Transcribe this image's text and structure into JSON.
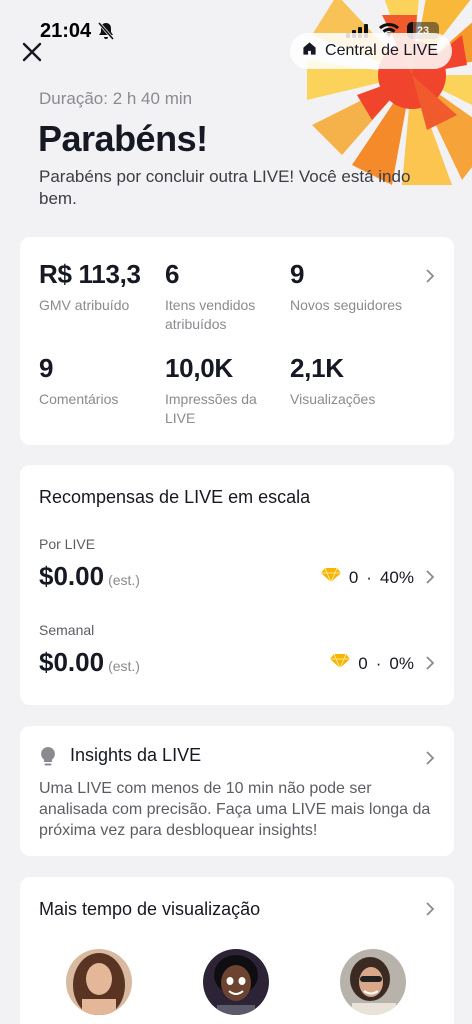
{
  "status": {
    "time": "21:04",
    "battery": "23"
  },
  "header": {
    "center_label": "Central de LIVE"
  },
  "summary": {
    "duration": "Duração: 2 h 40 min",
    "title": "Parabéns!",
    "subtitle": "Parabéns por concluir outra LIVE! Você está indo bem."
  },
  "stats": [
    {
      "value": "R$ 113,3",
      "label": "GMV atribuído"
    },
    {
      "value": "6",
      "label": "Itens vendidos atribuídos"
    },
    {
      "value": "9",
      "label": "Novos seguidores"
    },
    {
      "value": "9",
      "label": "Comentários"
    },
    {
      "value": "10,0K",
      "label": "Impressões da LIVE"
    },
    {
      "value": "2,1K",
      "label": "Visualizações"
    }
  ],
  "rewards": {
    "title": "Recompensas de LIVE em escala",
    "rows": [
      {
        "label": "Por LIVE",
        "amount": "$0.00",
        "est": "(est.)",
        "diamonds": "0",
        "separator": "·",
        "percent": "40%"
      },
      {
        "label": "Semanal",
        "amount": "$0.00",
        "est": "(est.)",
        "diamonds": "0",
        "separator": "·",
        "percent": "0%"
      }
    ]
  },
  "insights": {
    "title": "Insights da LIVE",
    "body": "Uma LIVE com menos de 10 min não pode ser analisada com precisão. Faça uma LIVE mais longa da próxima vez para desbloquear insights!"
  },
  "watch_time": {
    "title": "Mais tempo de visualização"
  },
  "colors": {
    "accent_orange": "#f5a623",
    "accent_red": "#f0442c",
    "diamond": "#f7b500"
  }
}
